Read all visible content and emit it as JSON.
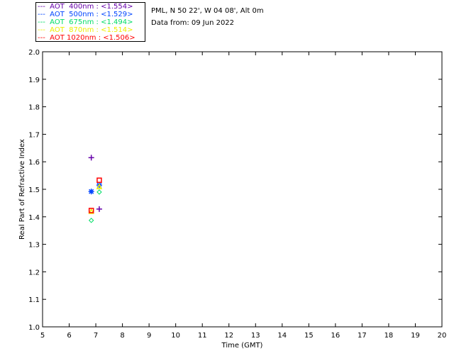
{
  "header": {
    "site": "PML, N 50 22', W 04 08', Alt 0m",
    "date": "Data from: 09 Jun 2022"
  },
  "chart_data": {
    "type": "scatter",
    "xlabel": "Time (GMT)",
    "ylabel": "Real Part of Refractive Index",
    "xlim": [
      5,
      20
    ],
    "ylim": [
      1.0,
      2.0
    ],
    "xticks": [
      "5",
      "6",
      "7",
      "8",
      "9",
      "10",
      "11",
      "12",
      "13",
      "14",
      "15",
      "16",
      "17",
      "18",
      "19",
      "20"
    ],
    "yticks": [
      "1.0",
      "1.1",
      "1.2",
      "1.3",
      "1.4",
      "1.5",
      "1.6",
      "1.7",
      "1.8",
      "1.9",
      "2.0"
    ],
    "legend_placement": "top-left outside",
    "series": [
      {
        "name": "AOT  400nm : <1.554>",
        "color": "#6600aa",
        "marker": "plus",
        "x": [
          6.83,
          7.13
        ],
        "y": [
          1.615,
          1.428
        ]
      },
      {
        "name": "AOT  500nm : <1.529>",
        "color": "#0044ff",
        "marker": "asterisk",
        "x": [
          6.83,
          7.13
        ],
        "y": [
          1.492,
          1.515
        ]
      },
      {
        "name": "AOT  675nm : <1.494>",
        "color": "#00dd66",
        "marker": "diamond",
        "x": [
          6.83,
          7.13
        ],
        "y": [
          1.387,
          1.49
        ]
      },
      {
        "name": "AOT  870nm : <1.514>",
        "color": "#eeee00",
        "marker": "triangle",
        "x": [
          6.83,
          7.13
        ],
        "y": [
          1.42,
          1.51
        ]
      },
      {
        "name": "AOT 1020nm : <1.506>",
        "color": "#ff0000",
        "marker": "square",
        "x": [
          6.83,
          7.13
        ],
        "y": [
          1.423,
          1.533
        ]
      }
    ]
  }
}
